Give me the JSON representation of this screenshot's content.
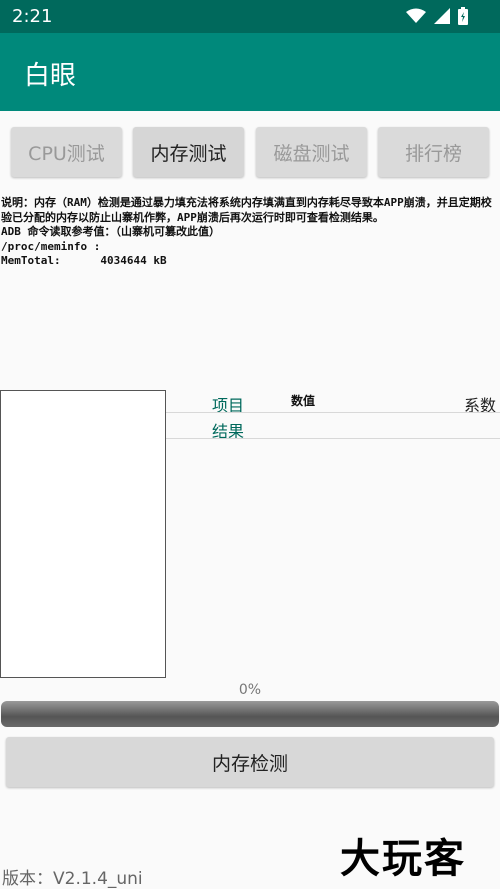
{
  "status_bar": {
    "time": "2:21"
  },
  "app": {
    "title": "白眼"
  },
  "tabs": [
    {
      "label": "CPU测试",
      "active": false
    },
    {
      "label": "内存测试",
      "active": true
    },
    {
      "label": "磁盘测试",
      "active": false
    },
    {
      "label": "排行榜",
      "active": false
    }
  ],
  "description": {
    "line1": "说明：内存（RAM）检测是通过暴力填充法将系统内存填满直到内存耗尽导致本APP崩溃，并且定期校验已分配的内存以防止山寨机作弊，APP崩溃后再次运行时即可查看检测结果。",
    "line2": "ADB 命令读取参考值：（山寨机可篡改此值）",
    "line3": "/proc/meminfo :",
    "line4": "MemTotal:      4034644 kB"
  },
  "table": {
    "col_item": "项目",
    "col_value": "数值",
    "col_factor": "系数",
    "row_result": "结果"
  },
  "progress": {
    "label": "0%",
    "value": 0
  },
  "run_button": {
    "label": "内存检测"
  },
  "version": "版本：V2.1.4_uni",
  "watermark": "大玩客",
  "colors": {
    "status_bar": "#00695c",
    "app_bar": "#00897b",
    "table_text": "#00695c"
  }
}
